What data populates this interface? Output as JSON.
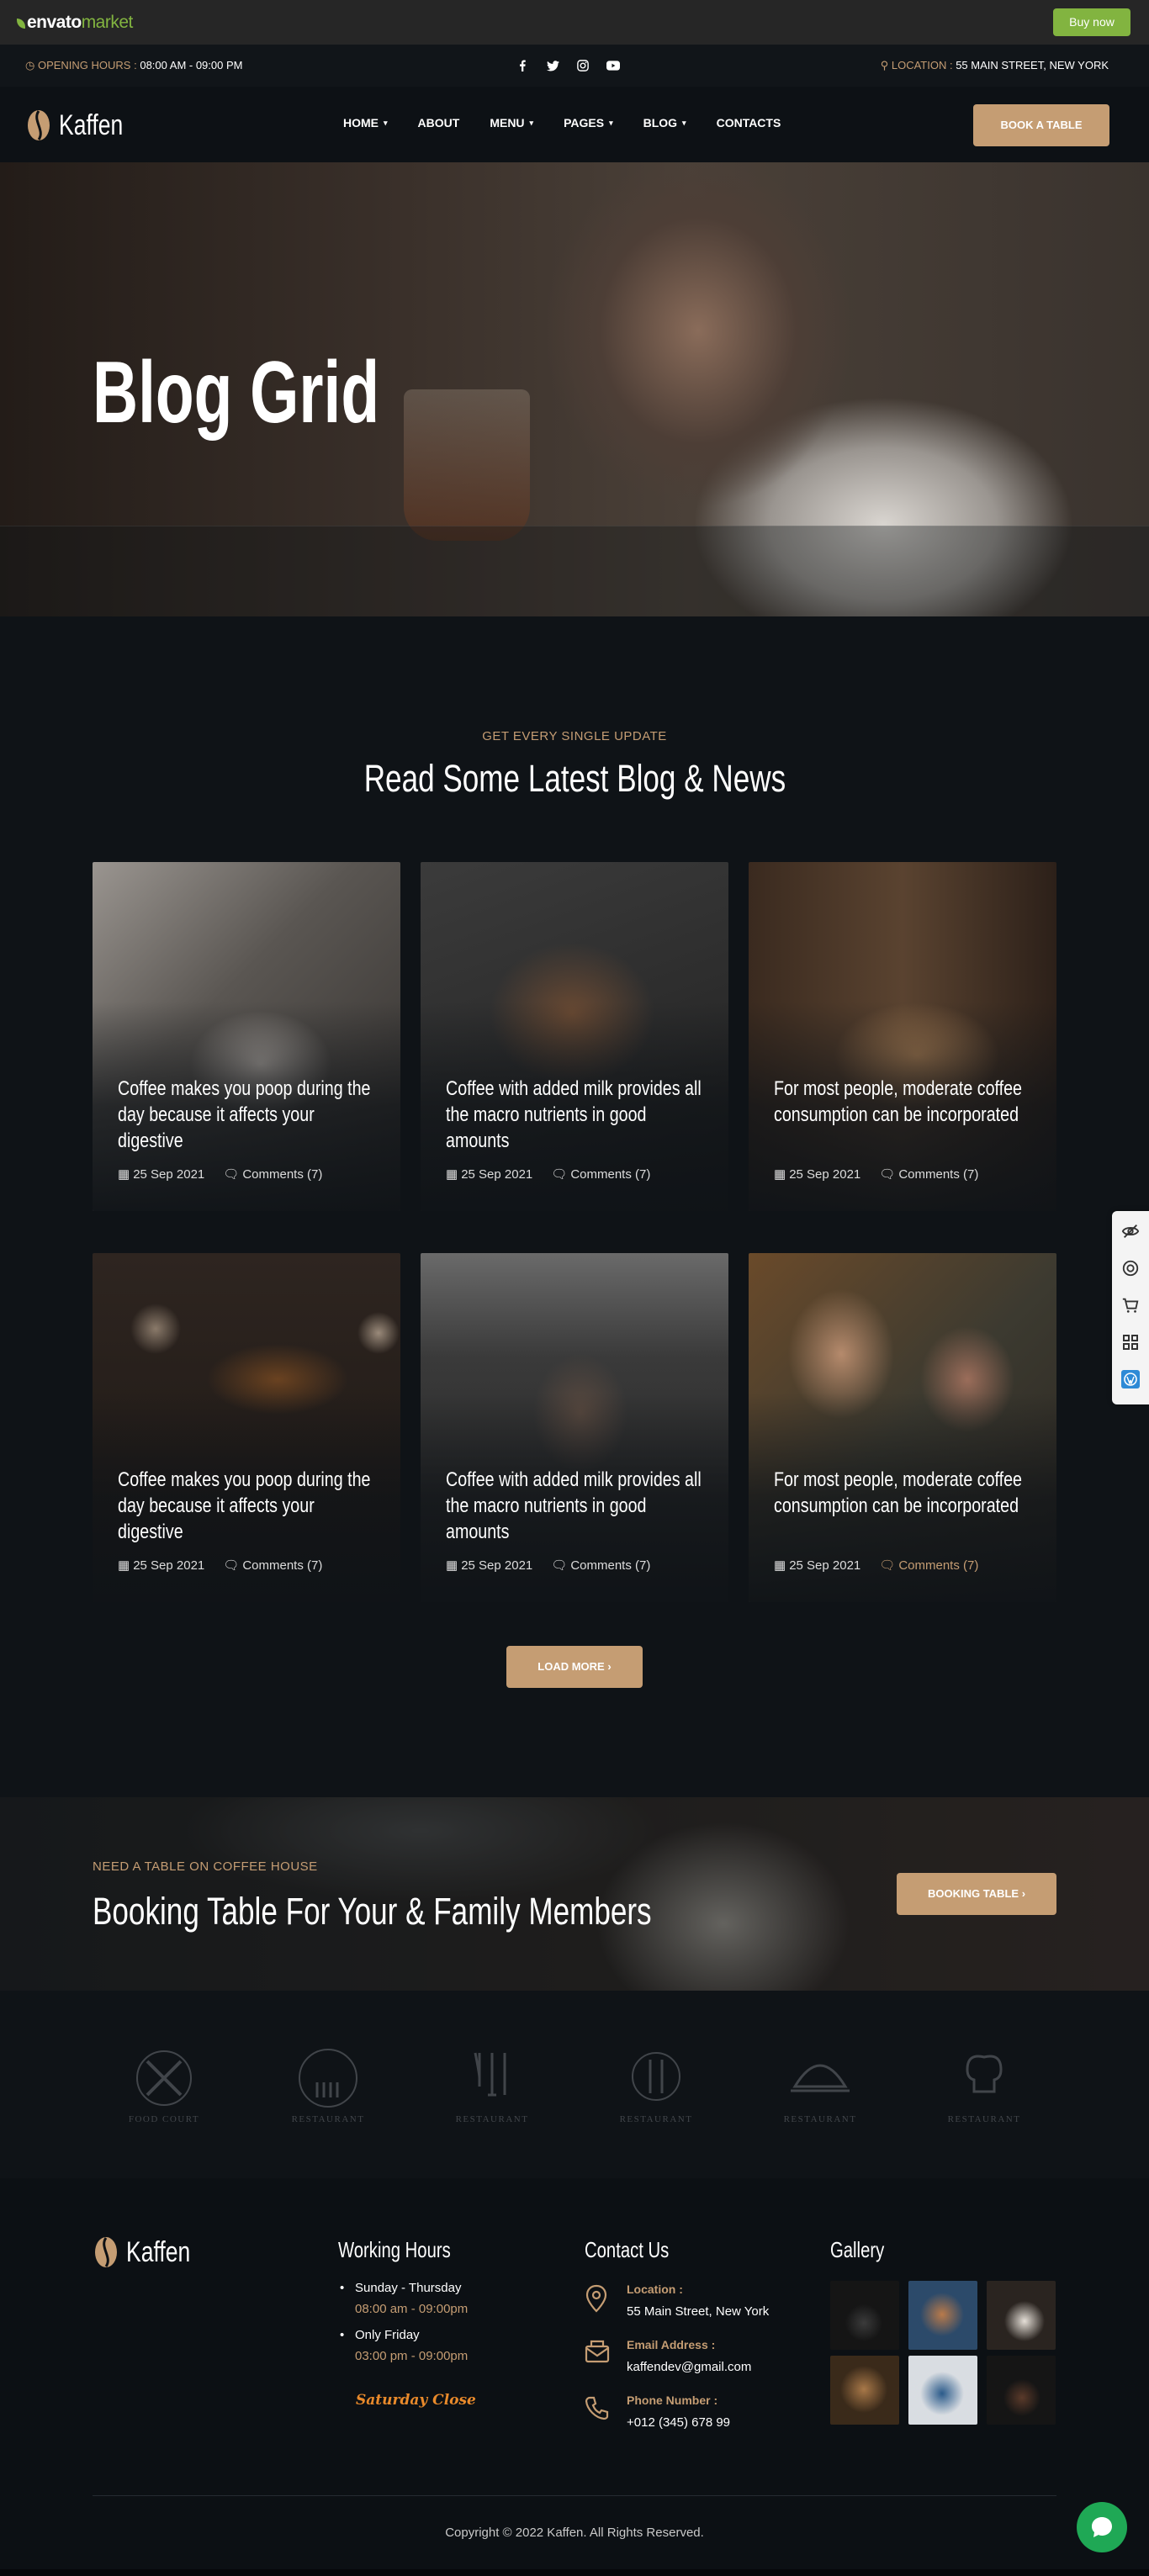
{
  "envato": {
    "logo_main": "envato",
    "logo_suffix": "market",
    "buy_label": "Buy now"
  },
  "topbar": {
    "hours_label": "OPENING HOURS :",
    "hours_value": "08:00 AM - 09:00 PM",
    "location_label": "LOCATION :",
    "location_value": "55 MAIN STREET, NEW YORK",
    "social_icons": [
      "facebook-icon",
      "twitter-icon",
      "instagram-icon",
      "youtube-icon"
    ]
  },
  "nav": {
    "brand": "Kaffen",
    "items": [
      {
        "label": "HOME",
        "dropdown": true
      },
      {
        "label": "ABOUT",
        "dropdown": false
      },
      {
        "label": "MENU",
        "dropdown": true
      },
      {
        "label": "PAGES",
        "dropdown": true
      },
      {
        "label": "BLOG",
        "dropdown": true
      },
      {
        "label": "CONTACTS",
        "dropdown": false
      }
    ],
    "cta": "BOOK A TABLE"
  },
  "hero": {
    "title": "Blog Grid"
  },
  "blog": {
    "eyebrow": "GET EVERY SINGLE UPDATE",
    "title": "Read Some Latest Blog & News",
    "posts": [
      {
        "title": "Coffee makes you poop during the day because it affects your digestive",
        "date": "25 Sep 2021",
        "comments": "Comments (7)"
      },
      {
        "title": "Coffee with added milk provides all the macro nutrients in good amounts",
        "date": "25 Sep 2021",
        "comments": "Comments (7)"
      },
      {
        "title": "For most people, moderate coffee consumption can be incorporated",
        "date": "25 Sep 2021",
        "comments": "Comments (7)"
      },
      {
        "title": "Coffee makes you poop during the day because it affects your digestive",
        "date": "25 Sep 2021",
        "comments": "Comments (7)"
      },
      {
        "title": "Coffee with added milk provides all the macro nutrients in good amounts",
        "date": "25 Sep 2021",
        "comments": "Comments (7)"
      },
      {
        "title": "For most people, moderate coffee consumption can be incorporated",
        "date": "25 Sep 2021",
        "comments": "Comments (7)"
      }
    ],
    "load_more": "LOAD MORE"
  },
  "booking": {
    "eyebrow": "NEED A TABLE ON COFFEE HOUSE",
    "title": "Booking Table For Your & Family Members",
    "button": "BOOKING TABLE"
  },
  "partners": [
    {
      "word": "FOOD COURT"
    },
    {
      "word": "RESTAURANT"
    },
    {
      "word": "RESTAURANT"
    },
    {
      "word": "RESTAURANT"
    },
    {
      "word": "RESTAURANT"
    },
    {
      "word": "RESTAURANT"
    }
  ],
  "footer": {
    "brand": "Kaffen",
    "working_hours": {
      "title": "Working Hours",
      "rows": [
        {
          "day": "Sunday - Thursday",
          "time": "08:00 am - 09:00pm"
        },
        {
          "day": "Only Friday",
          "time": "03:00 pm - 09:00pm"
        }
      ],
      "closed": "Saturday Close"
    },
    "contact": {
      "title": "Contact Us",
      "items": [
        {
          "label": "Location :",
          "value": "55 Main Street, New York",
          "icon": "map-pin-icon"
        },
        {
          "label": "Email Address :",
          "value": "kaffendev@gmail.com",
          "icon": "mail-icon"
        },
        {
          "label": "Phone Number :",
          "value": "+012 (345) 678 99",
          "icon": "phone-icon"
        }
      ]
    },
    "gallery": {
      "title": "Gallery"
    },
    "copyright": "Copyright © 2022 Kaffen. All Rights Reserved."
  },
  "colors": {
    "accent": "#c59d73",
    "background": "#0f1317",
    "envato_green": "#82b440",
    "closed_text": "#e98a2b"
  }
}
